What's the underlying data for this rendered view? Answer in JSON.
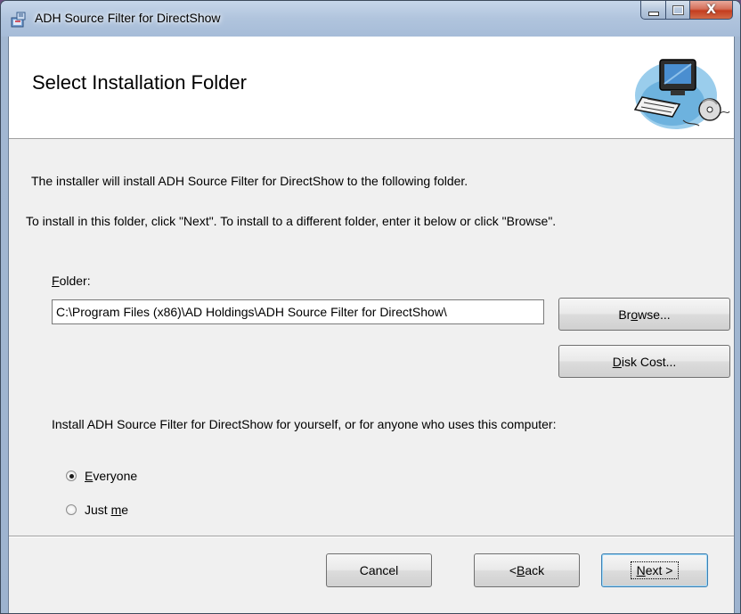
{
  "window": {
    "title": "ADH Source Filter for DirectShow",
    "icon": "installer-icon",
    "controls": {
      "minimize": "minimize-icon",
      "maximize": "maximize-icon",
      "close_symbol": "X"
    }
  },
  "banner": {
    "title": "Select Installation Folder",
    "graphic": "computer-cd-graphic"
  },
  "body": {
    "line1": "The installer will install ADH Source Filter for DirectShow to the following folder.",
    "line2": "To install in this folder, click \"Next\". To install to a different folder, enter it below or click \"Browse\"."
  },
  "folder": {
    "label_accel": "F",
    "label_rest": "older:",
    "value": "C:\\Program Files (x86)\\AD Holdings\\ADH Source Filter for DirectShow\\"
  },
  "buttons": {
    "browse": {
      "pre": "Br",
      "accel": "o",
      "post": "wse..."
    },
    "disk_cost": {
      "pre": "",
      "accel": "D",
      "post": "isk Cost..."
    },
    "cancel": "Cancel",
    "back": {
      "pre": "< ",
      "accel": "B",
      "post": "ack"
    },
    "next": {
      "pre": "",
      "accel": "N",
      "post": "ext >"
    }
  },
  "install_for": {
    "prompt": "Install ADH Source Filter for DirectShow for yourself, or for anyone who uses this computer:",
    "options": [
      {
        "pre": "",
        "accel": "E",
        "post": "veryone",
        "selected": true
      },
      {
        "pre": "Just ",
        "accel": "m",
        "post": "e",
        "selected": false
      }
    ]
  }
}
